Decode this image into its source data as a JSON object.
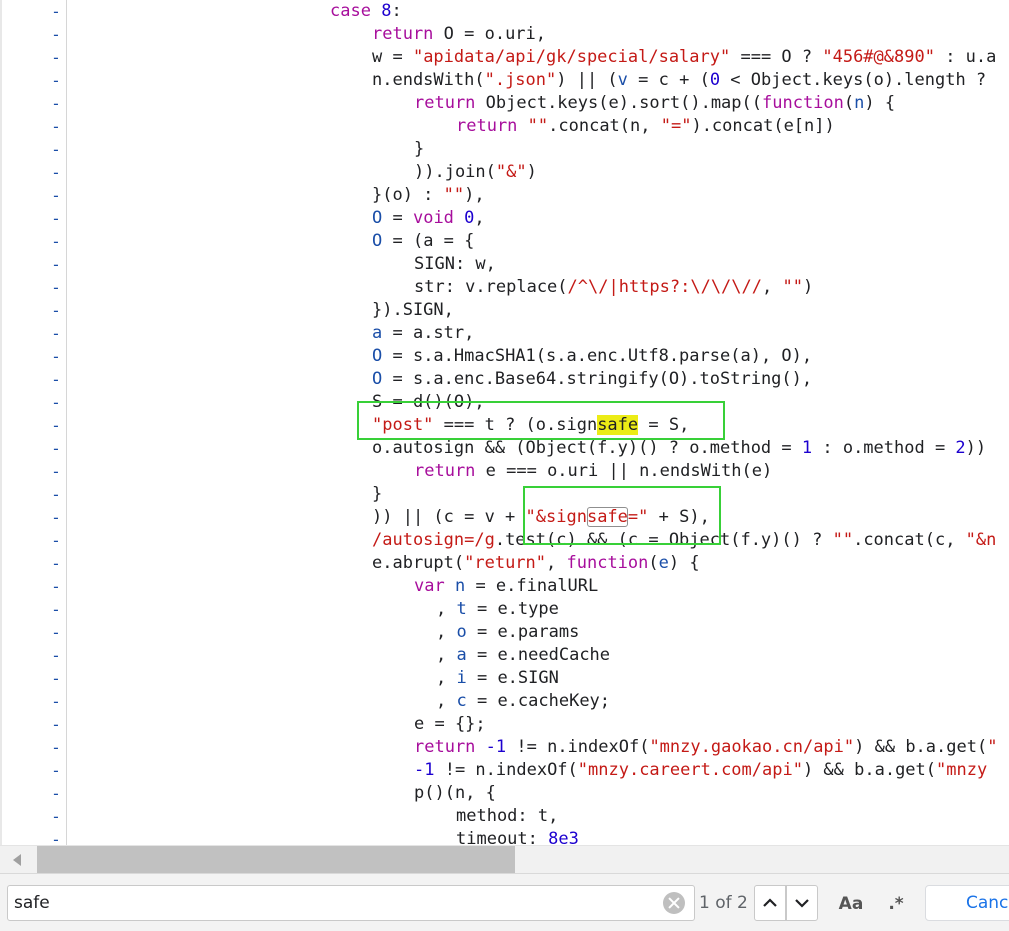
{
  "colors": {
    "keyword": "#a70e9c",
    "string": "#c41a16",
    "number": "#1c00cf",
    "variable": "#1a4ea8",
    "plain": "#202124",
    "search_highlight": "#ecec16",
    "annotation_box": "#38d038"
  },
  "gutter": {
    "marker": "-"
  },
  "code": {
    "lines": [
      {
        "tokens": [
          {
            "t": "case ",
            "c": "kw"
          },
          {
            "t": "8",
            "c": "num"
          },
          {
            "t": ":",
            "c": "plain"
          }
        ]
      },
      {
        "tokens": [
          {
            "t": "return ",
            "c": "kw"
          },
          {
            "t": "O = o.uri,",
            "c": "plain"
          }
        ]
      },
      {
        "tokens": [
          {
            "t": "w = ",
            "c": "plain"
          },
          {
            "t": "\"apidata/api/gk/special/salary\"",
            "c": "str"
          },
          {
            "t": " === O ? ",
            "c": "plain"
          },
          {
            "t": "\"456#@&890\"",
            "c": "str"
          },
          {
            "t": " : u.a",
            "c": "plain"
          }
        ]
      },
      {
        "tokens": [
          {
            "t": "n.endsWith(",
            "c": "plain"
          },
          {
            "t": "\".json\"",
            "c": "str"
          },
          {
            "t": ") || (",
            "c": "plain"
          },
          {
            "t": "v",
            "c": "var"
          },
          {
            "t": " = c + (",
            "c": "plain"
          },
          {
            "t": "0",
            "c": "num"
          },
          {
            "t": " < Object.keys(o).length ?",
            "c": "plain"
          }
        ]
      },
      {
        "tokens": [
          {
            "t": "return ",
            "c": "kw"
          },
          {
            "t": "Object.keys(e).sort().map((",
            "c": "plain"
          },
          {
            "t": "function",
            "c": "kw"
          },
          {
            "t": "(",
            "c": "plain"
          },
          {
            "t": "n",
            "c": "var"
          },
          {
            "t": ") {",
            "c": "plain"
          }
        ]
      },
      {
        "tokens": [
          {
            "t": "return ",
            "c": "kw"
          },
          {
            "t": "\"\"",
            "c": "str"
          },
          {
            "t": ".concat(n, ",
            "c": "plain"
          },
          {
            "t": "\"=\"",
            "c": "str"
          },
          {
            "t": ").concat(e[n])",
            "c": "plain"
          }
        ]
      },
      {
        "tokens": [
          {
            "t": "}",
            "c": "plain"
          }
        ]
      },
      {
        "tokens": [
          {
            "t": ")).join(",
            "c": "plain"
          },
          {
            "t": "\"&\"",
            "c": "str"
          },
          {
            "t": ")",
            "c": "plain"
          }
        ]
      },
      {
        "tokens": [
          {
            "t": "}(o) : ",
            "c": "plain"
          },
          {
            "t": "\"\"",
            "c": "str"
          },
          {
            "t": "),",
            "c": "plain"
          }
        ]
      },
      {
        "tokens": [
          {
            "t": "O",
            "c": "var"
          },
          {
            "t": " = ",
            "c": "plain"
          },
          {
            "t": "void ",
            "c": "kw"
          },
          {
            "t": "0",
            "c": "num"
          },
          {
            "t": ",",
            "c": "plain"
          }
        ]
      },
      {
        "tokens": [
          {
            "t": "O",
            "c": "var"
          },
          {
            "t": " = (a = {",
            "c": "plain"
          }
        ]
      },
      {
        "tokens": [
          {
            "t": "SIGN: w,",
            "c": "plain"
          }
        ]
      },
      {
        "tokens": [
          {
            "t": "str: v.replace(",
            "c": "plain"
          },
          {
            "t": "/^\\/|https?:\\/\\/\\//",
            "c": "str"
          },
          {
            "t": ", ",
            "c": "plain"
          },
          {
            "t": "\"\"",
            "c": "str"
          },
          {
            "t": ")",
            "c": "plain"
          }
        ]
      },
      {
        "tokens": [
          {
            "t": "}).SIGN,",
            "c": "plain"
          }
        ]
      },
      {
        "tokens": [
          {
            "t": "a",
            "c": "var"
          },
          {
            "t": " = a.str,",
            "c": "plain"
          }
        ]
      },
      {
        "tokens": [
          {
            "t": "O",
            "c": "var"
          },
          {
            "t": " = s.a.HmacSHA1(s.a.enc.Utf8.parse(a), O),",
            "c": "plain"
          }
        ]
      },
      {
        "tokens": [
          {
            "t": "O",
            "c": "var"
          },
          {
            "t": " = s.a.enc.Base64.stringify(O).toString(),",
            "c": "plain"
          }
        ]
      },
      {
        "tokens": [
          {
            "t": "S = d()(O),",
            "c": "plain"
          }
        ]
      },
      {
        "tokens": [
          {
            "t": "\"post\"",
            "c": "str"
          },
          {
            "t": " === t ? (o.sign",
            "c": "plain"
          },
          {
            "t": "safe",
            "c": "hl"
          },
          {
            "t": " = S,",
            "c": "plain"
          }
        ]
      },
      {
        "tokens": [
          {
            "t": "o.autosign && (Object(f.y)() ? o.method = ",
            "c": "plain"
          },
          {
            "t": "1",
            "c": "num"
          },
          {
            "t": " : o.method = ",
            "c": "plain"
          },
          {
            "t": "2",
            "c": "num"
          },
          {
            "t": "))",
            "c": "plain"
          }
        ]
      },
      {
        "tokens": [
          {
            "t": "return ",
            "c": "kw"
          },
          {
            "t": "e === o.uri || n.endsWith(e)",
            "c": "plain"
          }
        ]
      },
      {
        "tokens": [
          {
            "t": "}",
            "c": "plain"
          }
        ]
      },
      {
        "tokens": [
          {
            "t": ")) || (c = v + ",
            "c": "plain"
          },
          {
            "t": "\"&sign",
            "c": "str"
          },
          {
            "t": "safe",
            "c": "strbox"
          },
          {
            "t": "=\"",
            "c": "str"
          },
          {
            "t": " + S),",
            "c": "plain"
          }
        ]
      },
      {
        "tokens": [
          {
            "t": "/autosign=/g",
            "c": "str"
          },
          {
            "t": ".test(c) && (c = Object(f.y)() ? ",
            "c": "plain"
          },
          {
            "t": "\"\"",
            "c": "str"
          },
          {
            "t": ".concat(c, ",
            "c": "plain"
          },
          {
            "t": "\"&n",
            "c": "str"
          }
        ]
      },
      {
        "tokens": [
          {
            "t": "e.abrupt(",
            "c": "plain"
          },
          {
            "t": "\"return\"",
            "c": "str"
          },
          {
            "t": ", ",
            "c": "plain"
          },
          {
            "t": "function",
            "c": "kw"
          },
          {
            "t": "(",
            "c": "plain"
          },
          {
            "t": "e",
            "c": "var"
          },
          {
            "t": ") {",
            "c": "plain"
          }
        ]
      },
      {
        "tokens": [
          {
            "t": "var ",
            "c": "kw"
          },
          {
            "t": "n",
            "c": "var"
          },
          {
            "t": " = e.finalURL",
            "c": "plain"
          }
        ]
      },
      {
        "tokens": [
          {
            "t": ", ",
            "c": "plain"
          },
          {
            "t": "t",
            "c": "var"
          },
          {
            "t": " = e.type",
            "c": "plain"
          }
        ]
      },
      {
        "tokens": [
          {
            "t": ", ",
            "c": "plain"
          },
          {
            "t": "o",
            "c": "var"
          },
          {
            "t": " = e.params",
            "c": "plain"
          }
        ]
      },
      {
        "tokens": [
          {
            "t": ", ",
            "c": "plain"
          },
          {
            "t": "a",
            "c": "var"
          },
          {
            "t": " = e.needCache",
            "c": "plain"
          }
        ]
      },
      {
        "tokens": [
          {
            "t": ", ",
            "c": "plain"
          },
          {
            "t": "i",
            "c": "var"
          },
          {
            "t": " = e.SIGN",
            "c": "plain"
          }
        ]
      },
      {
        "tokens": [
          {
            "t": ", ",
            "c": "plain"
          },
          {
            "t": "c",
            "c": "var"
          },
          {
            "t": " = e.cacheKey;",
            "c": "plain"
          }
        ]
      },
      {
        "tokens": [
          {
            "t": "e = {};",
            "c": "plain"
          }
        ]
      },
      {
        "tokens": [
          {
            "t": "return ",
            "c": "kw"
          },
          {
            "t": "-1",
            "c": "num"
          },
          {
            "t": " != n.indexOf(",
            "c": "plain"
          },
          {
            "t": "\"mnzy.gaokao.cn/api\"",
            "c": "str"
          },
          {
            "t": ") && b.a.get(",
            "c": "plain"
          },
          {
            "t": "\"",
            "c": "str"
          }
        ]
      },
      {
        "tokens": [
          {
            "t": "-1",
            "c": "num"
          },
          {
            "t": " != n.indexOf(",
            "c": "plain"
          },
          {
            "t": "\"mnzy.careert.com/api\"",
            "c": "str"
          },
          {
            "t": ") && b.a.get(",
            "c": "plain"
          },
          {
            "t": "\"mnzy",
            "c": "str"
          }
        ]
      },
      {
        "tokens": [
          {
            "t": "p()(n, {",
            "c": "plain"
          }
        ]
      },
      {
        "tokens": [
          {
            "t": "method: t,",
            "c": "plain"
          }
        ]
      },
      {
        "tokens": [
          {
            "t": "timeout: ",
            "c": "plain"
          },
          {
            "t": "8e3",
            "c": "num"
          }
        ]
      }
    ]
  },
  "find_bar": {
    "query": "safe",
    "match_count": "1 of 2",
    "case_label": "Aa",
    "regex_label": ".*",
    "cancel_label": "Cancel"
  }
}
